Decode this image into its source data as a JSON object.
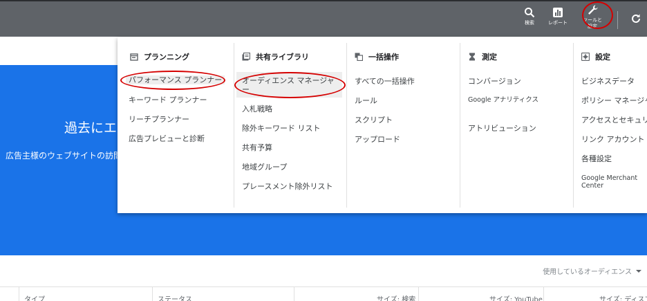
{
  "topbar": {
    "search_label": "検索",
    "reports_label": "レポート",
    "tools_label": "ツールと\n設定"
  },
  "hero": {
    "title": "過去にエ",
    "subtitle": "広告主様のウェブサイトの訪問"
  },
  "audience_dropdown": {
    "label": "使用しているオーディエンス"
  },
  "table_headers": [
    "タイプ",
    "ステータス",
    "サイズ: 検索",
    "サイズ: YouTube",
    "サイズ: ディスプ"
  ],
  "menu": {
    "planning": {
      "title": "プランニング",
      "icon": "calendar-icon",
      "items": [
        "パフォーマンス プランナー",
        "キーワード プランナー",
        "リーチプランナー",
        "広告プレビューと診断"
      ]
    },
    "library": {
      "title": "共有ライブラリ",
      "icon": "library-icon",
      "items": [
        "オーディエンス マネージャー",
        "入札戦略",
        "除外キーワード リスト",
        "共有予算",
        "地域グループ",
        "プレースメント除外リスト"
      ]
    },
    "bulk": {
      "title": "一括操作",
      "icon": "copy-icon",
      "items": [
        "すべての一括操作",
        "ルール",
        "スクリプト",
        "アップロード"
      ]
    },
    "measure": {
      "title": "測定",
      "icon": "hourglass-icon",
      "items": [
        "コンバージョン",
        "Google アナリティクス",
        "アトリビューション"
      ]
    },
    "settings": {
      "title": "設定",
      "icon": "settings-box-icon",
      "items": [
        "ビジネスデータ",
        "ポリシー マネージャ",
        "アクセスとセキュリ",
        "リンク アカウント",
        "各種設定",
        "Google Merchant Center"
      ]
    }
  },
  "colors": {
    "topbar": "#5f6368",
    "panel": "#1a73e8",
    "annotation": "#d50000"
  }
}
